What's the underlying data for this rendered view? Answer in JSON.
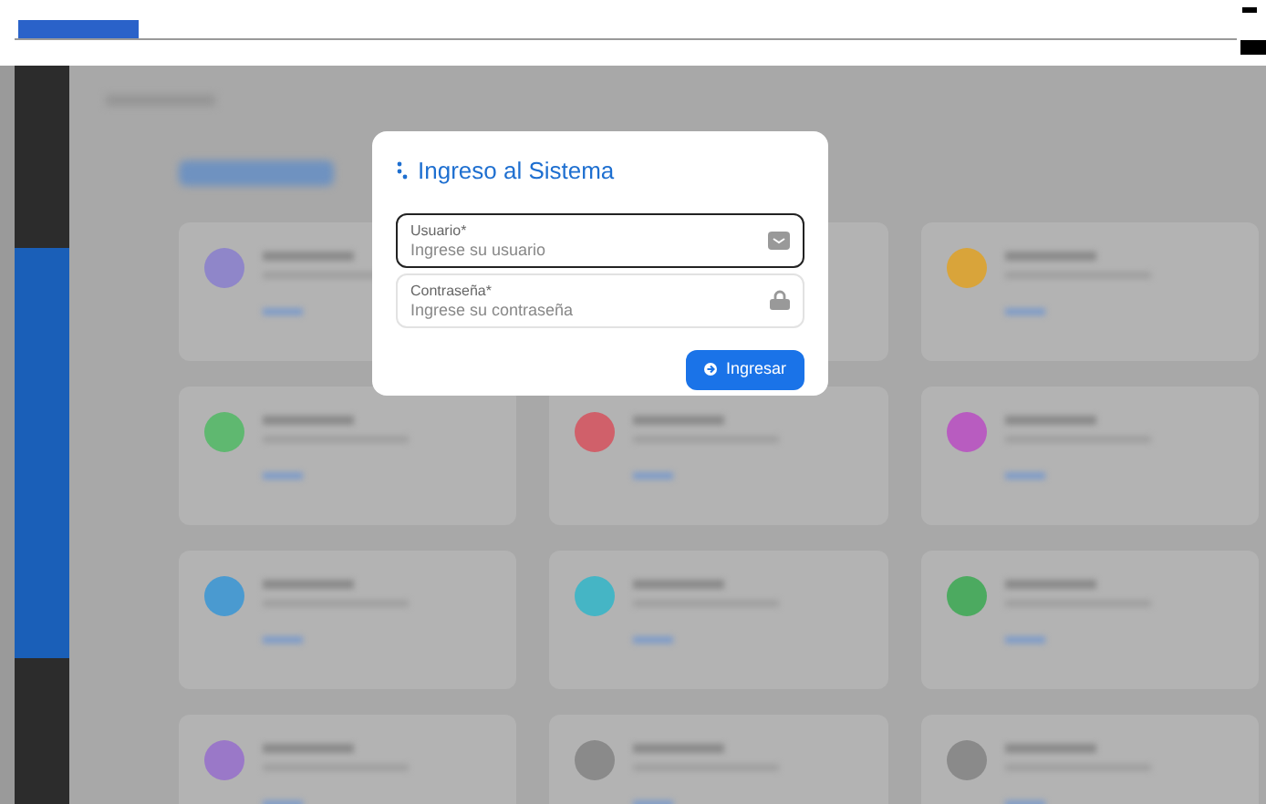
{
  "dialog": {
    "title": "Ingreso al Sistema",
    "fields": [
      {
        "kind": "user",
        "label": "Usuario*",
        "placeholder": "Ingrese su usuario",
        "focused": true
      },
      {
        "kind": "password",
        "label": "Contraseña*",
        "placeholder": "Ingrese su contraseña",
        "focused": false
      }
    ],
    "submit": "Ingresar"
  },
  "background_cards": [
    {
      "kind": "icon",
      "color": "#8f86c9"
    },
    {
      "kind": "covered"
    },
    {
      "kind": "icon",
      "color": "#d9a43a"
    },
    {
      "kind": "icon",
      "color": "#5fb870"
    },
    {
      "kind": "icon",
      "color": "#d0606a"
    },
    {
      "kind": "icon",
      "color": "#b85cc0"
    },
    {
      "kind": "icon",
      "color": "#4a9ad0"
    },
    {
      "kind": "icon",
      "color": "#45b5c5"
    },
    {
      "kind": "icon",
      "color": "#4caa60"
    },
    {
      "kind": "icon",
      "color": "#9a78c8"
    },
    {
      "kind": "icon",
      "color": "#8a8a8a"
    },
    {
      "kind": "icon",
      "color": "#8a8a8a"
    }
  ]
}
